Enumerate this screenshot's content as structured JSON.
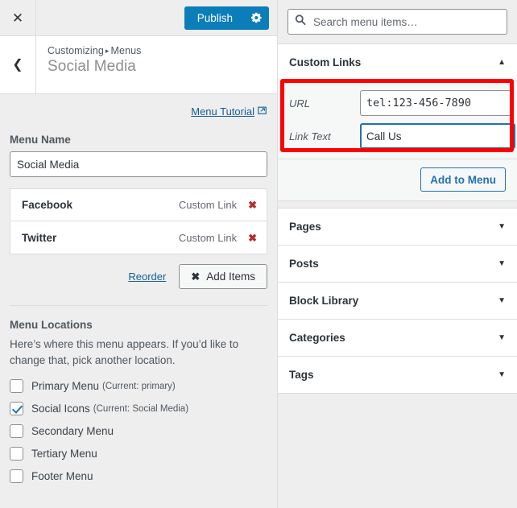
{
  "customizer": {
    "close_icon": "close-icon",
    "publish_label": "Publish",
    "gear_icon": "gear-icon",
    "back_icon": "chevron-left-icon",
    "breadcrumb_prefix": "Customizing",
    "breadcrumb_separator": "▸",
    "breadcrumb_current": "Menus",
    "section_title": "Social Media",
    "tutorial_label": "Menu Tutorial",
    "tutorial_icon": "external-link-icon",
    "menu_name_label": "Menu Name",
    "menu_name_value": "Social Media",
    "menu_name_placeholder": "Menu Name",
    "menu_items": [
      {
        "title": "Facebook",
        "type": "Custom Link",
        "remove_icon": "✖"
      },
      {
        "title": "Twitter",
        "type": "Custom Link",
        "remove_icon": "✖"
      }
    ],
    "reorder_label": "Reorder",
    "add_items_label": "Add Items",
    "add_items_icon": "✖",
    "locations_title": "Menu Locations",
    "locations_desc": "Here’s where this menu appears. If you’d like to change that, pick another location.",
    "locations": [
      {
        "label": "Primary Menu",
        "current": "(Current: primary)",
        "checked": false
      },
      {
        "label": "Social Icons",
        "current": "(Current: Social Media)",
        "checked": true
      },
      {
        "label": "Secondary Menu",
        "current": "",
        "checked": false
      },
      {
        "label": "Tertiary Menu",
        "current": "",
        "checked": false
      },
      {
        "label": "Footer Menu",
        "current": "",
        "checked": false
      }
    ]
  },
  "available_items": {
    "search_placeholder": "Search menu items…",
    "search_value": "",
    "search_icon": "search-icon",
    "custom_links": {
      "title": "Custom Links",
      "arrow": "▲",
      "url_label": "URL",
      "url_value": "tel:123-456-7890",
      "link_text_label": "Link Text",
      "link_text_value": "Call Us",
      "add_to_menu_label": "Add to Menu"
    },
    "sections": [
      {
        "title": "Pages",
        "arrow": "▼"
      },
      {
        "title": "Posts",
        "arrow": "▼"
      },
      {
        "title": "Block Library",
        "arrow": "▼"
      },
      {
        "title": "Categories",
        "arrow": "▼"
      },
      {
        "title": "Tags",
        "arrow": "▼"
      }
    ]
  },
  "annotation": {
    "highlight_color": "#fe0000"
  }
}
